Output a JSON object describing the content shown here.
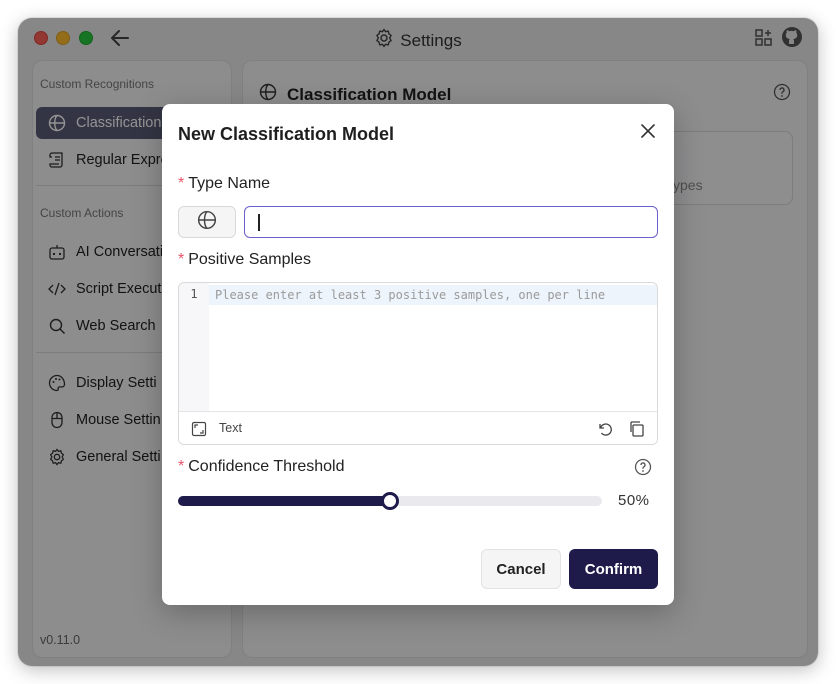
{
  "window": {
    "title": "Settings",
    "icons": {
      "back": "arrow-left-icon",
      "title": "gear-icon",
      "apps": "grid-plus-icon",
      "github": "github-icon"
    }
  },
  "sidebar": {
    "sections": [
      {
        "title": "Custom Recognitions"
      },
      {
        "title": "Custom Actions"
      }
    ],
    "items": [
      {
        "label": "Classification",
        "icon": "globe-icon",
        "active": true
      },
      {
        "label": "Regular Expre",
        "icon": "scroll-icon",
        "active": false
      },
      {
        "label": "AI Conversati",
        "icon": "robot-icon",
        "active": false
      },
      {
        "label": "Script Executi",
        "icon": "code-icon",
        "active": false
      },
      {
        "label": "Web Search",
        "icon": "search-icon",
        "active": false
      },
      {
        "label": "Display Setti",
        "icon": "palette-icon",
        "active": false
      },
      {
        "label": "Mouse Settin",
        "icon": "mouse-icon",
        "active": false
      },
      {
        "label": "General Setti",
        "icon": "gear-icon",
        "active": false
      }
    ],
    "version": "v0.11.0"
  },
  "main": {
    "title": "Classification Model",
    "types_text": "ypes"
  },
  "dialog": {
    "title": "New Classification Model",
    "type_name": {
      "label": "Type Name",
      "required_mark": "*",
      "value": ""
    },
    "positive_samples": {
      "label": "Positive Samples",
      "required_mark": "*",
      "line_number": "1",
      "placeholder": "Please enter at least 3 positive samples, one per line",
      "language": "Text"
    },
    "confidence": {
      "label": "Confidence Threshold",
      "required_mark": "*",
      "value": 0.5,
      "value_text": "50%"
    },
    "cancel_label": "Cancel",
    "confirm_label": "Confirm"
  },
  "colors": {
    "accent": "#1e1b4b",
    "required": "#e8566b",
    "input_focus": "#6b5fc9",
    "sidebar_active": "#5a5c75"
  }
}
